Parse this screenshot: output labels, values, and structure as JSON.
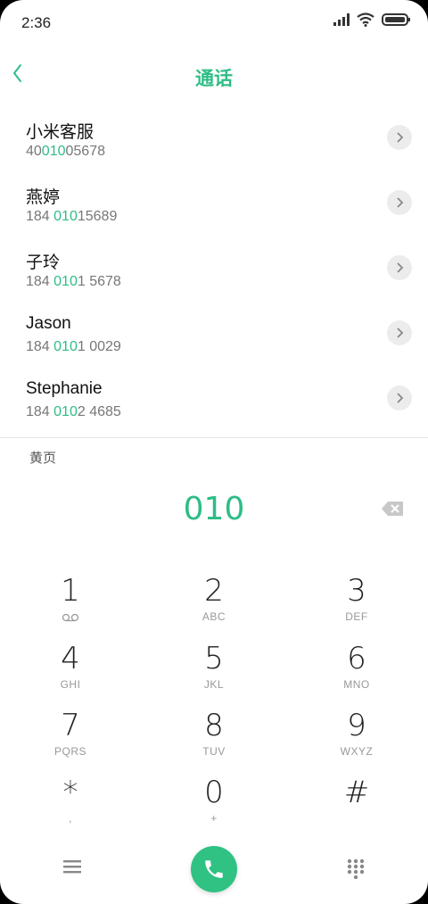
{
  "status": {
    "time": "2:36"
  },
  "header": {
    "title": "通话"
  },
  "contacts": [
    {
      "name": "小米客服",
      "num_pre": "40",
      "num_hl": "010",
      "num_post": "05678"
    },
    {
      "name": "燕婷",
      "num_pre": "184 ",
      "num_hl": "010",
      "num_post": "15689"
    },
    {
      "name": "子玲",
      "num_pre": "184 ",
      "num_hl": "010",
      "num_post": "1 5678"
    },
    {
      "name": "Jason",
      "num_pre": "184 ",
      "num_hl": "010",
      "num_post": "1 0029"
    },
    {
      "name": "Stephanie",
      "num_pre": "184 ",
      "num_hl": "010",
      "num_post": "2 4685"
    }
  ],
  "yellow_pages": "黄页",
  "dialed": "010",
  "keys": [
    {
      "num": "1",
      "sub": ""
    },
    {
      "num": "2",
      "sub": "ABC"
    },
    {
      "num": "3",
      "sub": "DEF"
    },
    {
      "num": "4",
      "sub": "GHI"
    },
    {
      "num": "5",
      "sub": "JKL"
    },
    {
      "num": "6",
      "sub": "MNO"
    },
    {
      "num": "7",
      "sub": "PQRS"
    },
    {
      "num": "8",
      "sub": "TUV"
    },
    {
      "num": "9",
      "sub": "WXYZ"
    },
    {
      "num": "*",
      "sub": ","
    },
    {
      "num": "0",
      "sub": "+"
    },
    {
      "num": "#",
      "sub": ""
    }
  ],
  "colors": {
    "accent": "#2ebd86",
    "call": "#2fc283"
  }
}
